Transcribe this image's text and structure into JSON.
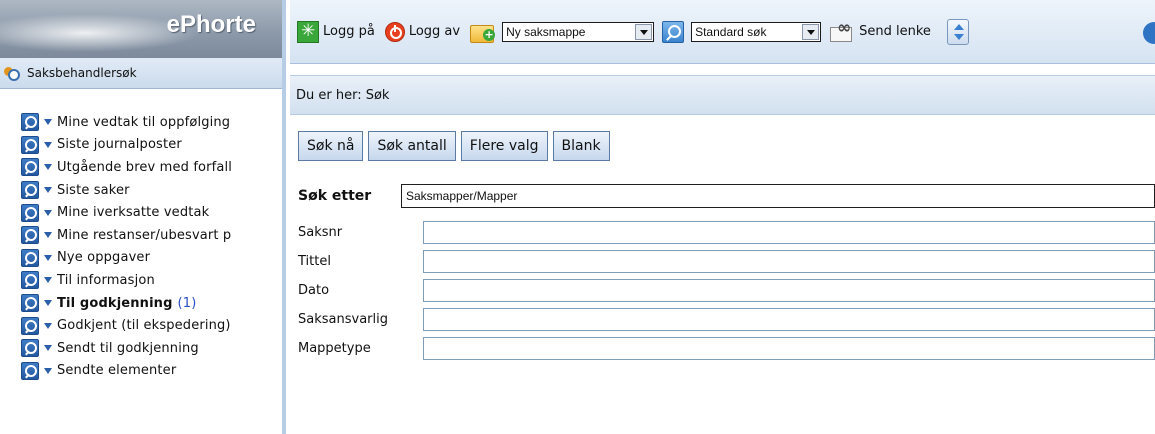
{
  "logo": {
    "text": "ePhorte"
  },
  "sidebar": {
    "header": "Saksbehandlersøk",
    "items": [
      {
        "label": "Mine vedtak til oppfølging",
        "bold": false
      },
      {
        "label": "Siste journalposter",
        "bold": false
      },
      {
        "label": "Utgående brev med forfall",
        "bold": false
      },
      {
        "label": "Siste saker",
        "bold": false
      },
      {
        "label": "Mine iverksatte vedtak",
        "bold": false
      },
      {
        "label": "Mine restanser/ubesvart p",
        "bold": false
      },
      {
        "label": "Nye oppgaver",
        "bold": false
      },
      {
        "label": "Til informasjon",
        "bold": false
      },
      {
        "label": "Til godkjenning",
        "bold": true,
        "count": "(1)"
      },
      {
        "label": "Godkjent (til ekspedering)",
        "bold": false
      },
      {
        "label": "Sendt til godkjenning",
        "bold": false
      },
      {
        "label": "Sendte elementer",
        "bold": false
      }
    ]
  },
  "toolbar": {
    "login_label": "Logg på",
    "logout_label": "Logg av",
    "new_case_folder_select": "Ny saksmappe",
    "search_type_select": "Standard søk",
    "send_link_label": "Send lenke"
  },
  "breadcrumb": {
    "text": "Du er her: Søk"
  },
  "actions": {
    "search_now": "Søk nå",
    "search_count": "Søk antall",
    "more_options": "Flere valg",
    "blank": "Blank"
  },
  "form": {
    "search_for_label": "Søk etter",
    "search_for_value": "Saksmapper/Mapper",
    "fields": [
      {
        "label": "Saksnr",
        "value": ""
      },
      {
        "label": "Tittel",
        "value": ""
      },
      {
        "label": "Dato",
        "value": ""
      },
      {
        "label": "Saksansvarlig",
        "value": ""
      },
      {
        "label": "Mappetype",
        "value": ""
      }
    ]
  }
}
